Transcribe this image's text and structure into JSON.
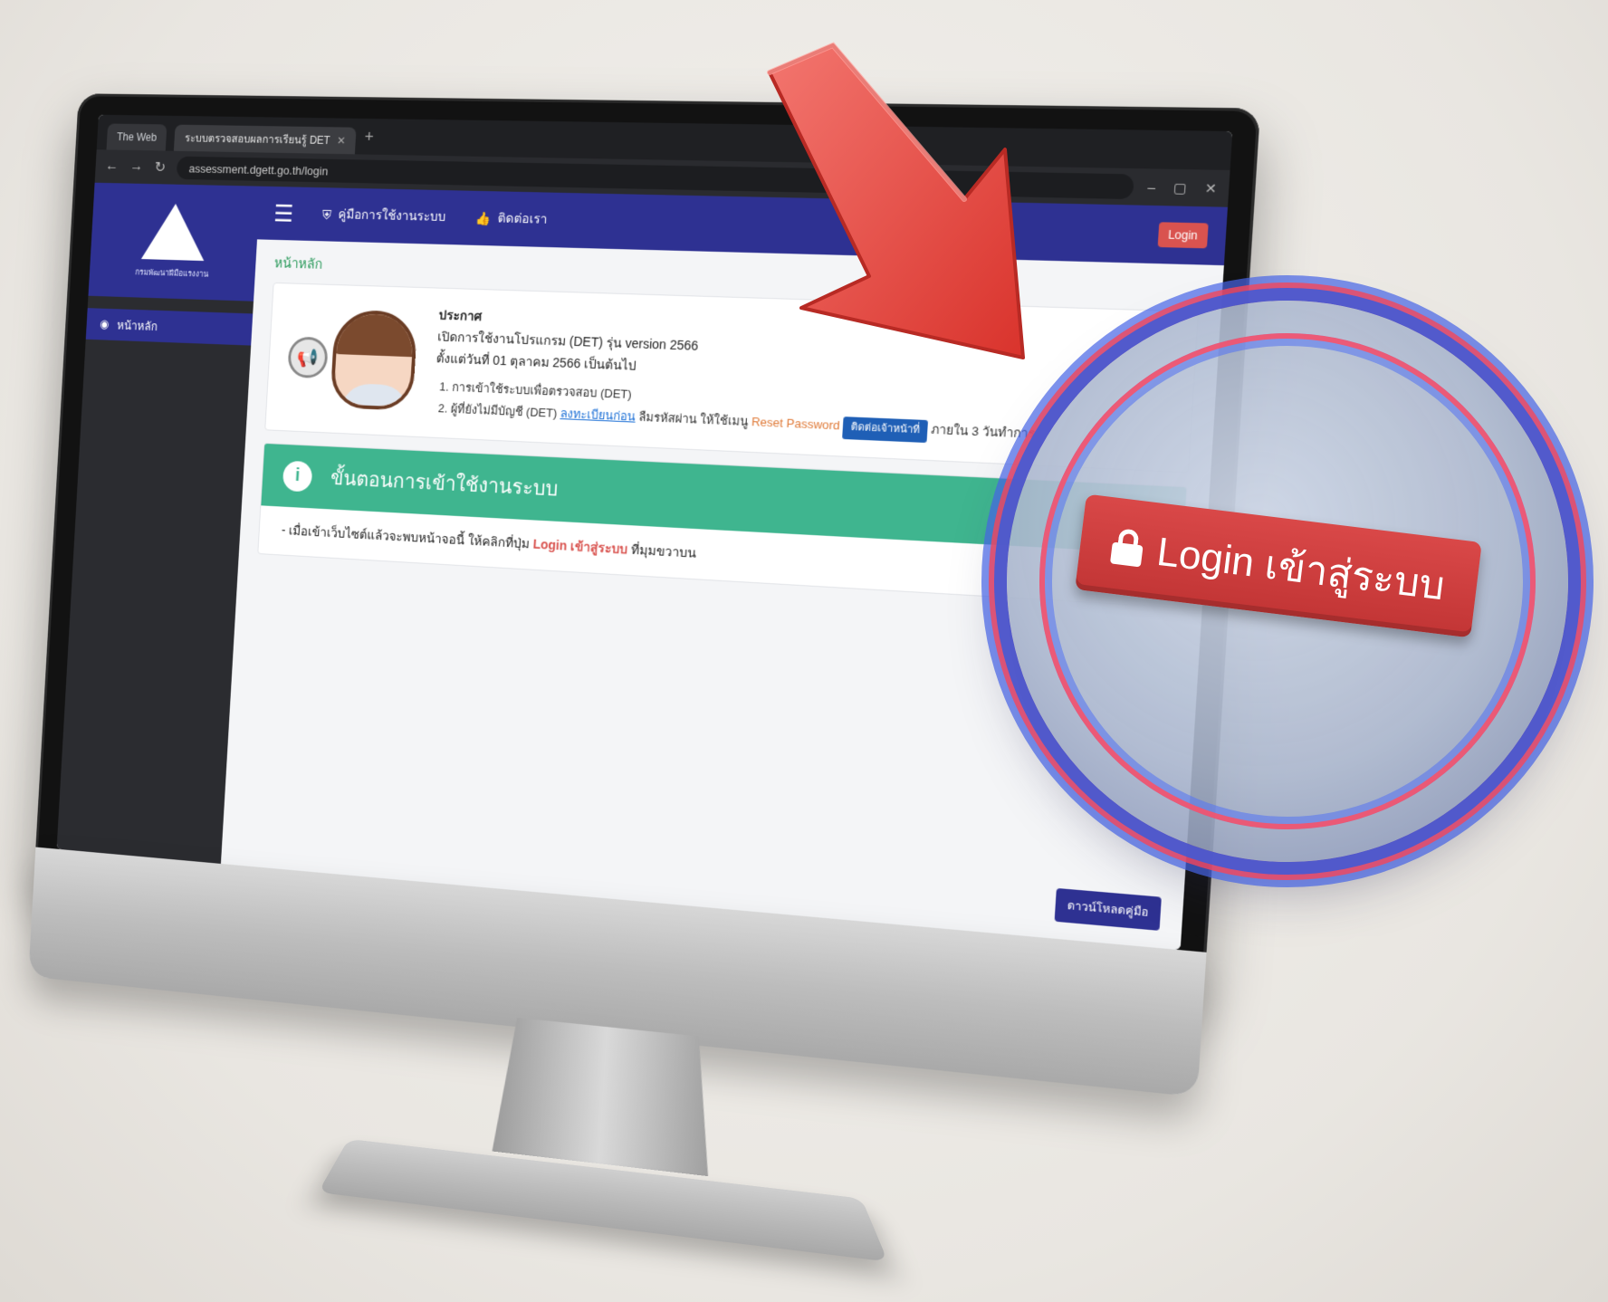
{
  "browser": {
    "tabs": [
      {
        "label": "The Web",
        "active": false
      },
      {
        "label": "ระบบตรวจสอบผลการเรียนรู้ DET",
        "active": true
      }
    ],
    "url": "assessment.dgett.go.th/login"
  },
  "app": {
    "brand_subtitle": "กรมพัฒนาฝีมือแรงงาน",
    "sidebar": {
      "items": [
        {
          "label": "หน้าหลัก"
        }
      ]
    },
    "topnav": {
      "items": [
        {
          "icon": "shield-icon",
          "label": "คู่มือการใช้งานระบบ"
        },
        {
          "icon": "thumbs-up-icon",
          "label": "ติดต่อเรา"
        }
      ],
      "login_label": "Login"
    },
    "breadcrumb": "หน้าหลัก",
    "announcement": {
      "title": "ประกาศ",
      "line1": "เปิดการใช้งานโปรแกรม (DET) รุ่น version 2566",
      "line2": "ตั้งแต่วันที่ 01 ตุลาคม 2566 เป็นต้นไป",
      "item1": "การเข้าใช้ระบบเพื่อตรวจสอบ (DET)",
      "item2_prefix": "ผู้ที่ยังไม่มีบัญชี (DET)",
      "item2_link": "ลงทะเบียนก่อน",
      "item2_mid": "ลืมรหัสผ่าน ให้ใช้เมนู",
      "item2_reset": "Reset Password",
      "item2_button": "ติดต่อเจ้าหน้าที่",
      "item2_suffix": "ภายใน 3 วันทำการ"
    },
    "info": {
      "header": "ขั้นตอนการเข้าใช้งานระบบ",
      "body_prefix": "- เมื่อเข้าเว็บไซต์แล้วจะพบหน้าจอนี้ ให้คลิกที่ปุ่ม",
      "body_highlight": "Login เข้าสู่ระบบ",
      "body_suffix": "ที่มุมขวาบน"
    },
    "bottom_button": "ดาวน์โหลดคู่มือ"
  },
  "callout": {
    "login_label": "Login เข้าสู่ระบบ",
    "colors": {
      "button": "#c23535",
      "ring_blue": "#3a5cdc",
      "ring_red": "#f5465a",
      "arrow": "#ec4b45"
    }
  }
}
